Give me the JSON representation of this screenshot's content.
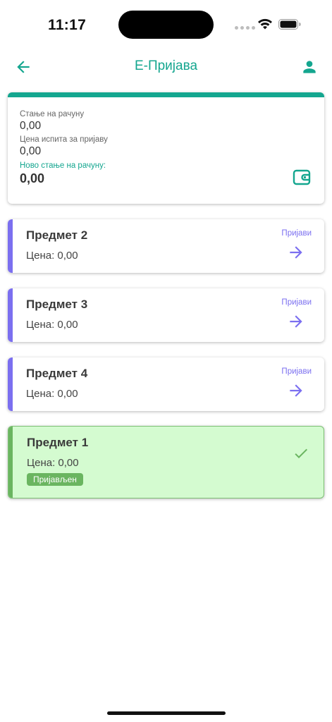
{
  "status_bar": {
    "time": "11:17"
  },
  "header": {
    "title": "Е-Пријава",
    "back_icon": "arrow-left-icon",
    "profile_icon": "person-icon"
  },
  "colors": {
    "teal": "#14a68f",
    "purple": "#7b6ff0",
    "green": "#6ab560",
    "green_bg": "#d4fbd0"
  },
  "balance": {
    "account_label": "Стање на рачуну",
    "account_value": "0,00",
    "exam_price_label": "Цена испита за пријаву",
    "exam_price_value": "0,00",
    "new_balance_label": "Ново стање на рачуну:",
    "new_balance_value": "0,00",
    "icon": "wallet-icon"
  },
  "subjects": [
    {
      "name": "Предмет 2",
      "price": "Цена: 0,00",
      "action": "Пријави",
      "registered": false
    },
    {
      "name": "Предмет 3",
      "price": "Цена: 0,00",
      "action": "Пријави",
      "registered": false
    },
    {
      "name": "Предмет 4",
      "price": "Цена: 0,00",
      "action": "Пријави",
      "registered": false
    },
    {
      "name": "Предмет 1",
      "price": "Цена: 0,00",
      "badge": "Пријављен",
      "registered": true
    }
  ]
}
